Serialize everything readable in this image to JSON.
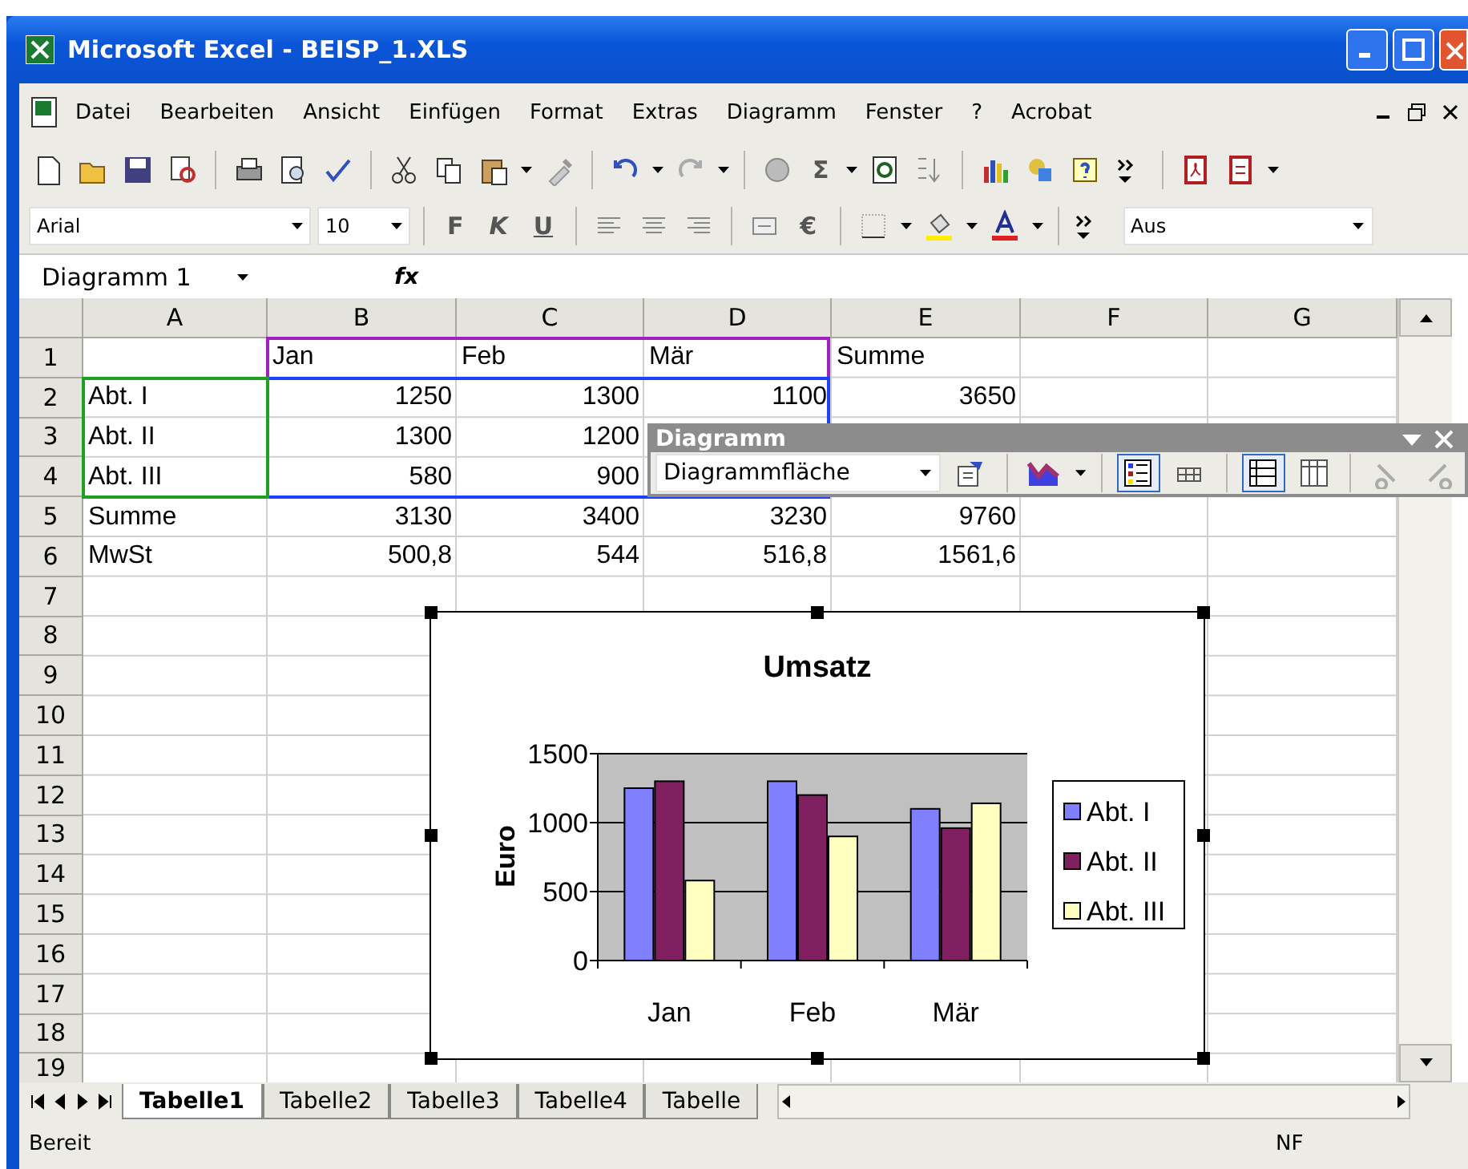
{
  "window": {
    "title": "Microsoft Excel - BEISP_1.XLS"
  },
  "menu": [
    "Datei",
    "Bearbeiten",
    "Ansicht",
    "Einfügen",
    "Format",
    "Extras",
    "Diagramm",
    "Fenster",
    "?",
    "Acrobat"
  ],
  "standard_toolbar": {
    "sum_label": "Σ"
  },
  "formatting_toolbar": {
    "font": "Arial",
    "size": "10",
    "bold": "F",
    "italic": "K",
    "underline": "U",
    "euro": "€",
    "zoom_box": "Aus"
  },
  "formula_bar": {
    "name_box": "Diagramm 1",
    "fx_label": "fx"
  },
  "sheet": {
    "columns": [
      "A",
      "B",
      "C",
      "D",
      "E",
      "F",
      "G"
    ],
    "rows": [
      {
        "header": "1",
        "kind": "heading",
        "values": [
          "Jan",
          "Feb",
          "Mär",
          "Summe"
        ]
      },
      {
        "header": "2",
        "label": "Abt. I",
        "values": [
          "1250",
          "1300",
          "1100",
          "3650"
        ]
      },
      {
        "header": "3",
        "label": "Abt. II",
        "values": [
          "1300",
          "1200"
        ]
      },
      {
        "header": "4",
        "label": "Abt. III",
        "values": [
          "580",
          "900"
        ]
      },
      {
        "header": "5",
        "label": "Summe",
        "values": [
          "3130",
          "3400",
          "3230",
          "9760"
        ]
      },
      {
        "header": "6",
        "label": "MwSt",
        "values": [
          "500,8",
          "544",
          "516,8",
          "1561,6"
        ]
      },
      {
        "header": "7"
      },
      {
        "header": "8"
      },
      {
        "header": "9"
      },
      {
        "header": "10"
      },
      {
        "header": "11"
      },
      {
        "header": "12"
      },
      {
        "header": "13"
      },
      {
        "header": "14"
      },
      {
        "header": "15"
      },
      {
        "header": "16"
      },
      {
        "header": "17"
      },
      {
        "header": "18"
      },
      {
        "header": "19"
      }
    ]
  },
  "chart": {
    "chart_data": {
      "type": "bar",
      "title": "Umsatz",
      "ylabel": "Euro",
      "categories": [
        "Jan",
        "Feb",
        "Mär"
      ],
      "series": [
        {
          "name": "Abt. I",
          "color": "#8080ff",
          "values": [
            1250,
            1300,
            1100
          ]
        },
        {
          "name": "Abt. II",
          "color": "#802060",
          "values": [
            1300,
            1200,
            960
          ]
        },
        {
          "name": "Abt. III",
          "color": "#ffffc0",
          "values": [
            580,
            900,
            1140
          ]
        }
      ],
      "ylim": [
        0,
        1500
      ],
      "yticks": [
        0,
        500,
        1000,
        1500
      ],
      "legend": "right"
    }
  },
  "chart_toolbar": {
    "title": "Diagramm",
    "element_select": "Diagrammfläche",
    "legend_pressed": true,
    "by_row_pressed": true
  },
  "sheet_tabs": [
    {
      "label": "Tabelle1",
      "selected": true
    },
    {
      "label": "Tabelle2",
      "selected": false
    },
    {
      "label": "Tabelle3",
      "selected": false
    },
    {
      "label": "Tabelle4",
      "selected": false
    },
    {
      "label": "Tabelle",
      "selected": false
    }
  ],
  "status_bar": {
    "text": "Bereit",
    "indicator": "NF"
  }
}
